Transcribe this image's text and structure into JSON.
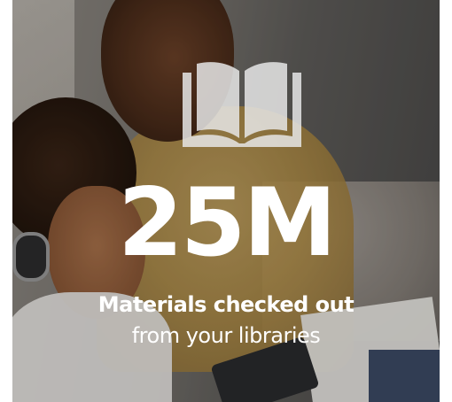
{
  "stat": {
    "value": "25M",
    "headline": "Materials checked out",
    "subline": "from your libraries"
  },
  "icon": "open-book-icon",
  "colors": {
    "text": "#ffffff",
    "icon_fill": "#e6e6e6"
  }
}
